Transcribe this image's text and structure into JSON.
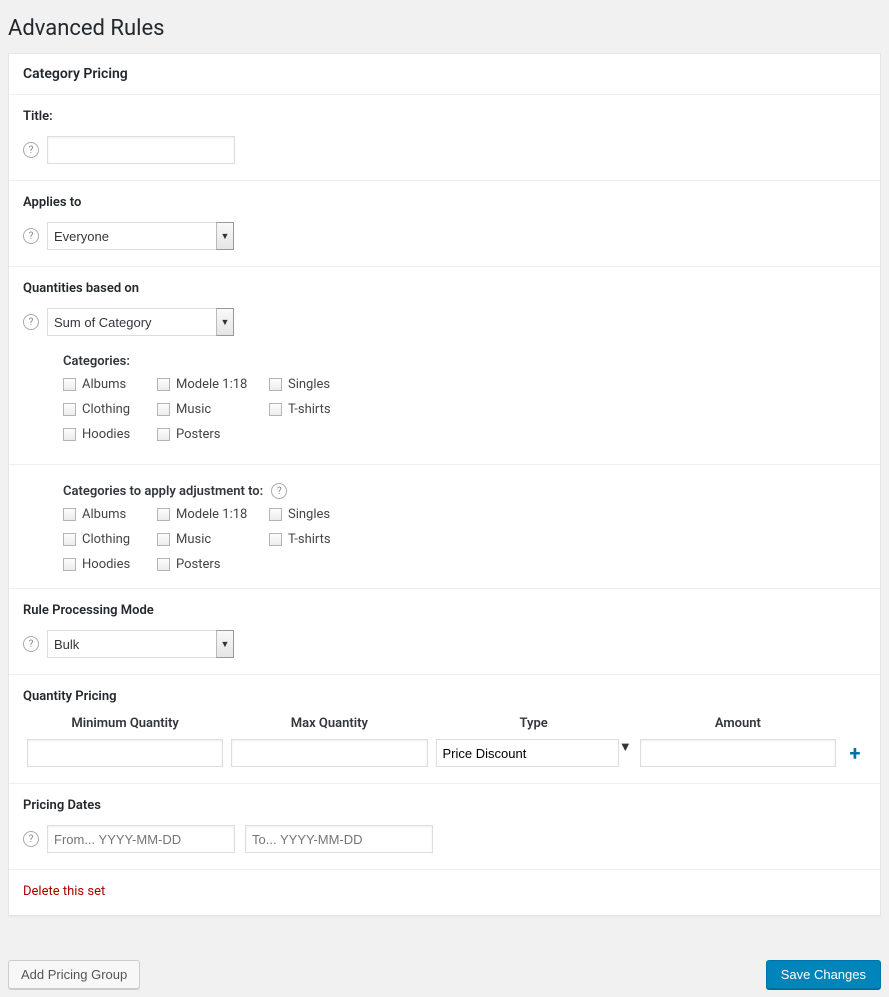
{
  "page_title": "Advanced Rules",
  "panel_title": "Category Pricing",
  "sections": {
    "title": {
      "label": "Title:",
      "value": ""
    },
    "applies_to": {
      "label": "Applies to",
      "selected": "Everyone"
    },
    "quantities": {
      "label": "Quantities based on",
      "selected": "Sum of Category",
      "categories_label": "Categories:",
      "categories": [
        "Albums",
        "Modele 1:18",
        "Singles",
        "Clothing",
        "Music",
        "T-shirts",
        "Hoodies",
        "Posters"
      ],
      "apply_to_label": "Categories to apply adjustment to:",
      "apply_to": [
        "Albums",
        "Modele 1:18",
        "Singles",
        "Clothing",
        "Music",
        "T-shirts",
        "Hoodies",
        "Posters"
      ]
    },
    "processing": {
      "label": "Rule Processing Mode",
      "selected": "Bulk"
    },
    "pricing": {
      "label": "Quantity Pricing",
      "cols": {
        "min": "Minimum Quantity",
        "max": "Max Quantity",
        "type": "Type",
        "amount": "Amount"
      },
      "row": {
        "min": "",
        "max": "",
        "type": "Price Discount",
        "amount": ""
      }
    },
    "dates": {
      "label": "Pricing Dates",
      "from_placeholder": "From... YYYY-MM-DD",
      "to_placeholder": "To... YYYY-MM-DD"
    }
  },
  "delete_link": "Delete this set",
  "buttons": {
    "add_group": "Add Pricing Group",
    "save": "Save Changes"
  }
}
